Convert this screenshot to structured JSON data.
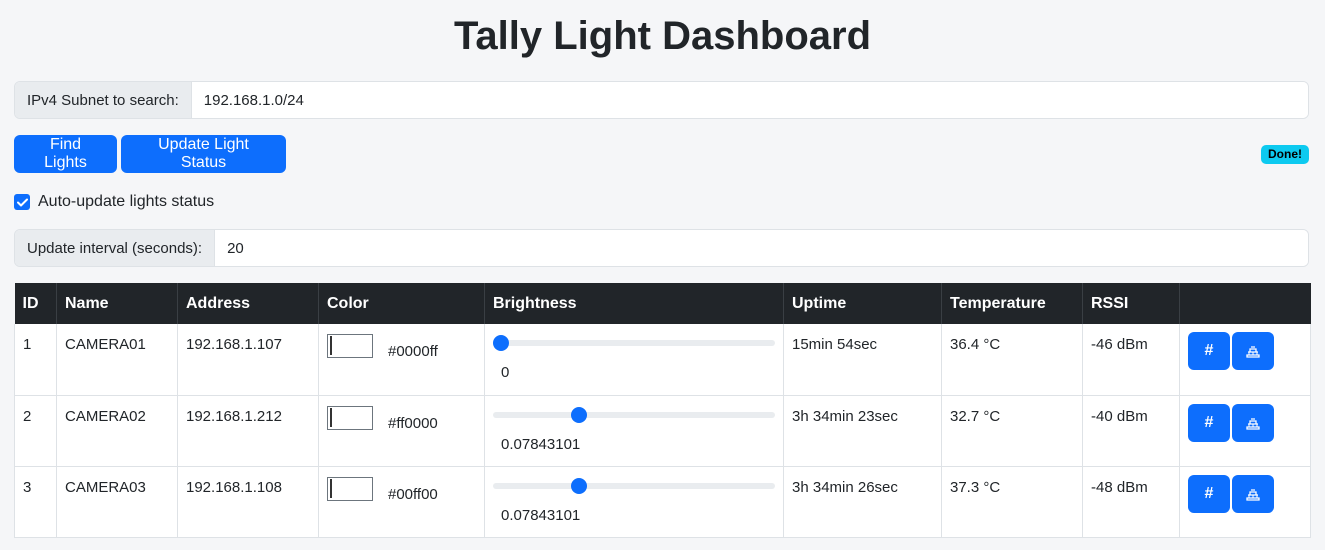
{
  "title": "Tally Light Dashboard",
  "subnet": {
    "label": "IPv4 Subnet to search:",
    "value": "192.168.1.0/24"
  },
  "buttons": {
    "find": "Find Lights",
    "update": "Update Light Status"
  },
  "status_badge": "Done!",
  "auto_update": {
    "label": "Auto-update lights status",
    "checked": true
  },
  "interval": {
    "label": "Update interval (seconds):",
    "value": "20"
  },
  "table": {
    "headers": [
      "ID",
      "Name",
      "Address",
      "Color",
      "Brightness",
      "Uptime",
      "Temperature",
      "RSSI",
      ""
    ],
    "rows": [
      {
        "id": "1",
        "name": "CAMERA01",
        "address": "192.168.1.107",
        "color": "#0000ff",
        "color_text": "#0000ff",
        "brightness_level": 0,
        "brightness": "0",
        "uptime": "15min 54sec",
        "temperature": "36.4 °C",
        "rssi": "-46 dBm"
      },
      {
        "id": "2",
        "name": "CAMERA02",
        "address": "192.168.1.212",
        "color": "#ff0000",
        "color_text": "#ff0000",
        "brightness_level": 0.07843101,
        "brightness": "0.07843101",
        "uptime": "3h 34min 23sec",
        "temperature": "32.7 °C",
        "rssi": "-40 dBm"
      },
      {
        "id": "3",
        "name": "CAMERA03",
        "address": "192.168.1.108",
        "color": "#00ff00",
        "color_text": "#00ff00",
        "brightness_level": 0.07843101,
        "brightness": "0.07843101",
        "uptime": "3h 34min 26sec",
        "temperature": "37.3 °C",
        "rssi": "-48 dBm"
      }
    ],
    "action_labels": {
      "identify": "#",
      "rename": ""
    }
  },
  "icons": {
    "check": "check-icon",
    "rename": "tally-device-icon"
  },
  "colors": {
    "primary": "#0d6efd",
    "header_bg": "#212529",
    "badge": "#0dcaf0"
  }
}
